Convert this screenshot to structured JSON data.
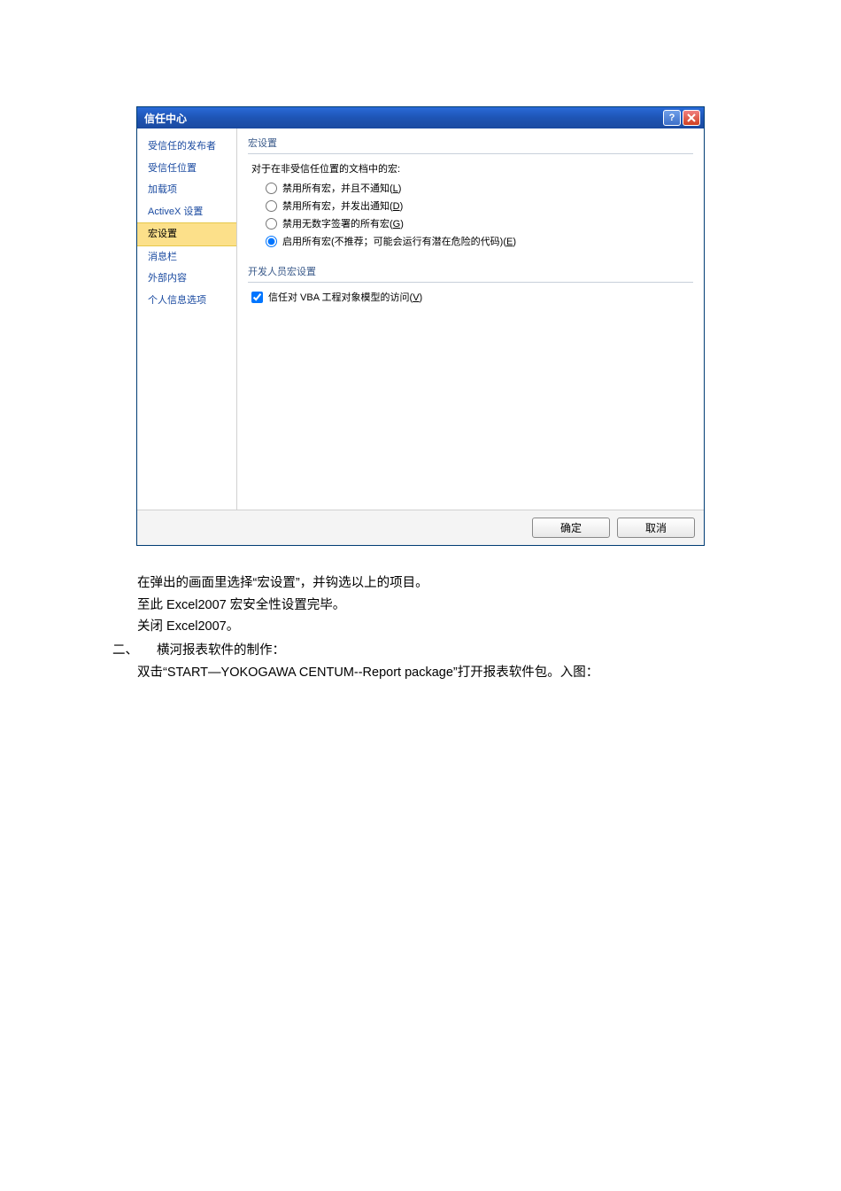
{
  "dialog": {
    "title": "信任中心",
    "sidebar": {
      "items": [
        "受信任的发布者",
        "受信任位置",
        "加载项",
        "ActiveX 设置",
        "宏设置",
        "消息栏",
        "外部内容",
        "个人信息选项"
      ],
      "selectedIndex": 4
    },
    "macro": {
      "section_title": "宏设置",
      "intro": "对于在非受信任位置的文档中的宏:",
      "options": [
        {
          "pre": "禁用所有宏，并且不通知(",
          "hk": "L",
          "post": ")"
        },
        {
          "pre": "禁用所有宏，并发出通知(",
          "hk": "D",
          "post": ")"
        },
        {
          "pre": "禁用无数字签署的所有宏(",
          "hk": "G",
          "post": ")"
        },
        {
          "pre": "启用所有宏(不推荐；可能会运行有潜在危险的代码)(",
          "hk": "E",
          "post": ")"
        }
      ],
      "selectedOption": 3
    },
    "dev": {
      "section_title": "开发人员宏设置",
      "checkbox": {
        "pre": "信任对 VBA 工程对象模型的访问(",
        "hk": "V",
        "post": ")"
      },
      "checked": true
    },
    "buttons": {
      "ok": "确定",
      "cancel": "取消"
    }
  },
  "doc": {
    "p1": "在弹出的画面里选择“宏设置”，并钩选以上的项目。",
    "p2": "至此 Excel2007 宏安全性设置完毕。",
    "p3": "关闭 Excel2007。",
    "num": "二、",
    "num_title": "横河报表软件的制作：",
    "p4": "双击“START—YOKOGAWA CENTUM--Report package”打开报表软件包。入图："
  }
}
